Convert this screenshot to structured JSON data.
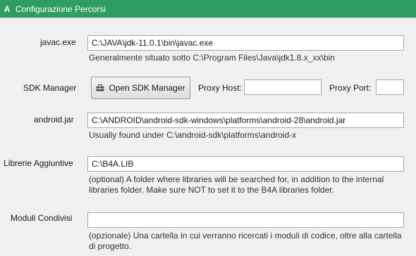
{
  "window": {
    "title": "Configurazione Percorsi",
    "app_icon_letter": "A",
    "accent": "#2e9d61"
  },
  "javac": {
    "label": "javac.exe",
    "value": "C:\\JAVA\\jdk-11.0.1\\bin\\javac.exe",
    "hint": "Generalmente situato sotto C:\\Program Files\\Java\\jdk1.8.x_xx\\bin"
  },
  "sdk_manager": {
    "label": "SDK Manager",
    "button_label": "Open SDK Manager",
    "button_icon": "toolbox-icon",
    "proxy_host_label": "Proxy Host:",
    "proxy_host_value": "",
    "proxy_port_label": "Proxy Port:",
    "proxy_port_value": ""
  },
  "android_jar": {
    "label": "android.jar",
    "value": "C:\\ANDROID\\android-sdk-windows\\platforms\\android-28\\android.jar",
    "hint": "Usually found under C:\\android-sdk\\platforms\\android-x"
  },
  "additional_libs": {
    "label": "Librerie Aggiuntive",
    "value": "C:\\B4A.LIB",
    "hint_line1": "(optional) A folder where libraries will be searched for, in addition to the internal",
    "hint_line2": "libraries folder. Make sure NOT to set it to the B4A libraries folder."
  },
  "shared_modules": {
    "label": "Moduli Condivisi",
    "value": "",
    "hint_line1": "(opzionale) Una cartella in cui verranno ricercati i moduli di codice, oltre alla cartella",
    "hint_line2": "di progetto."
  }
}
